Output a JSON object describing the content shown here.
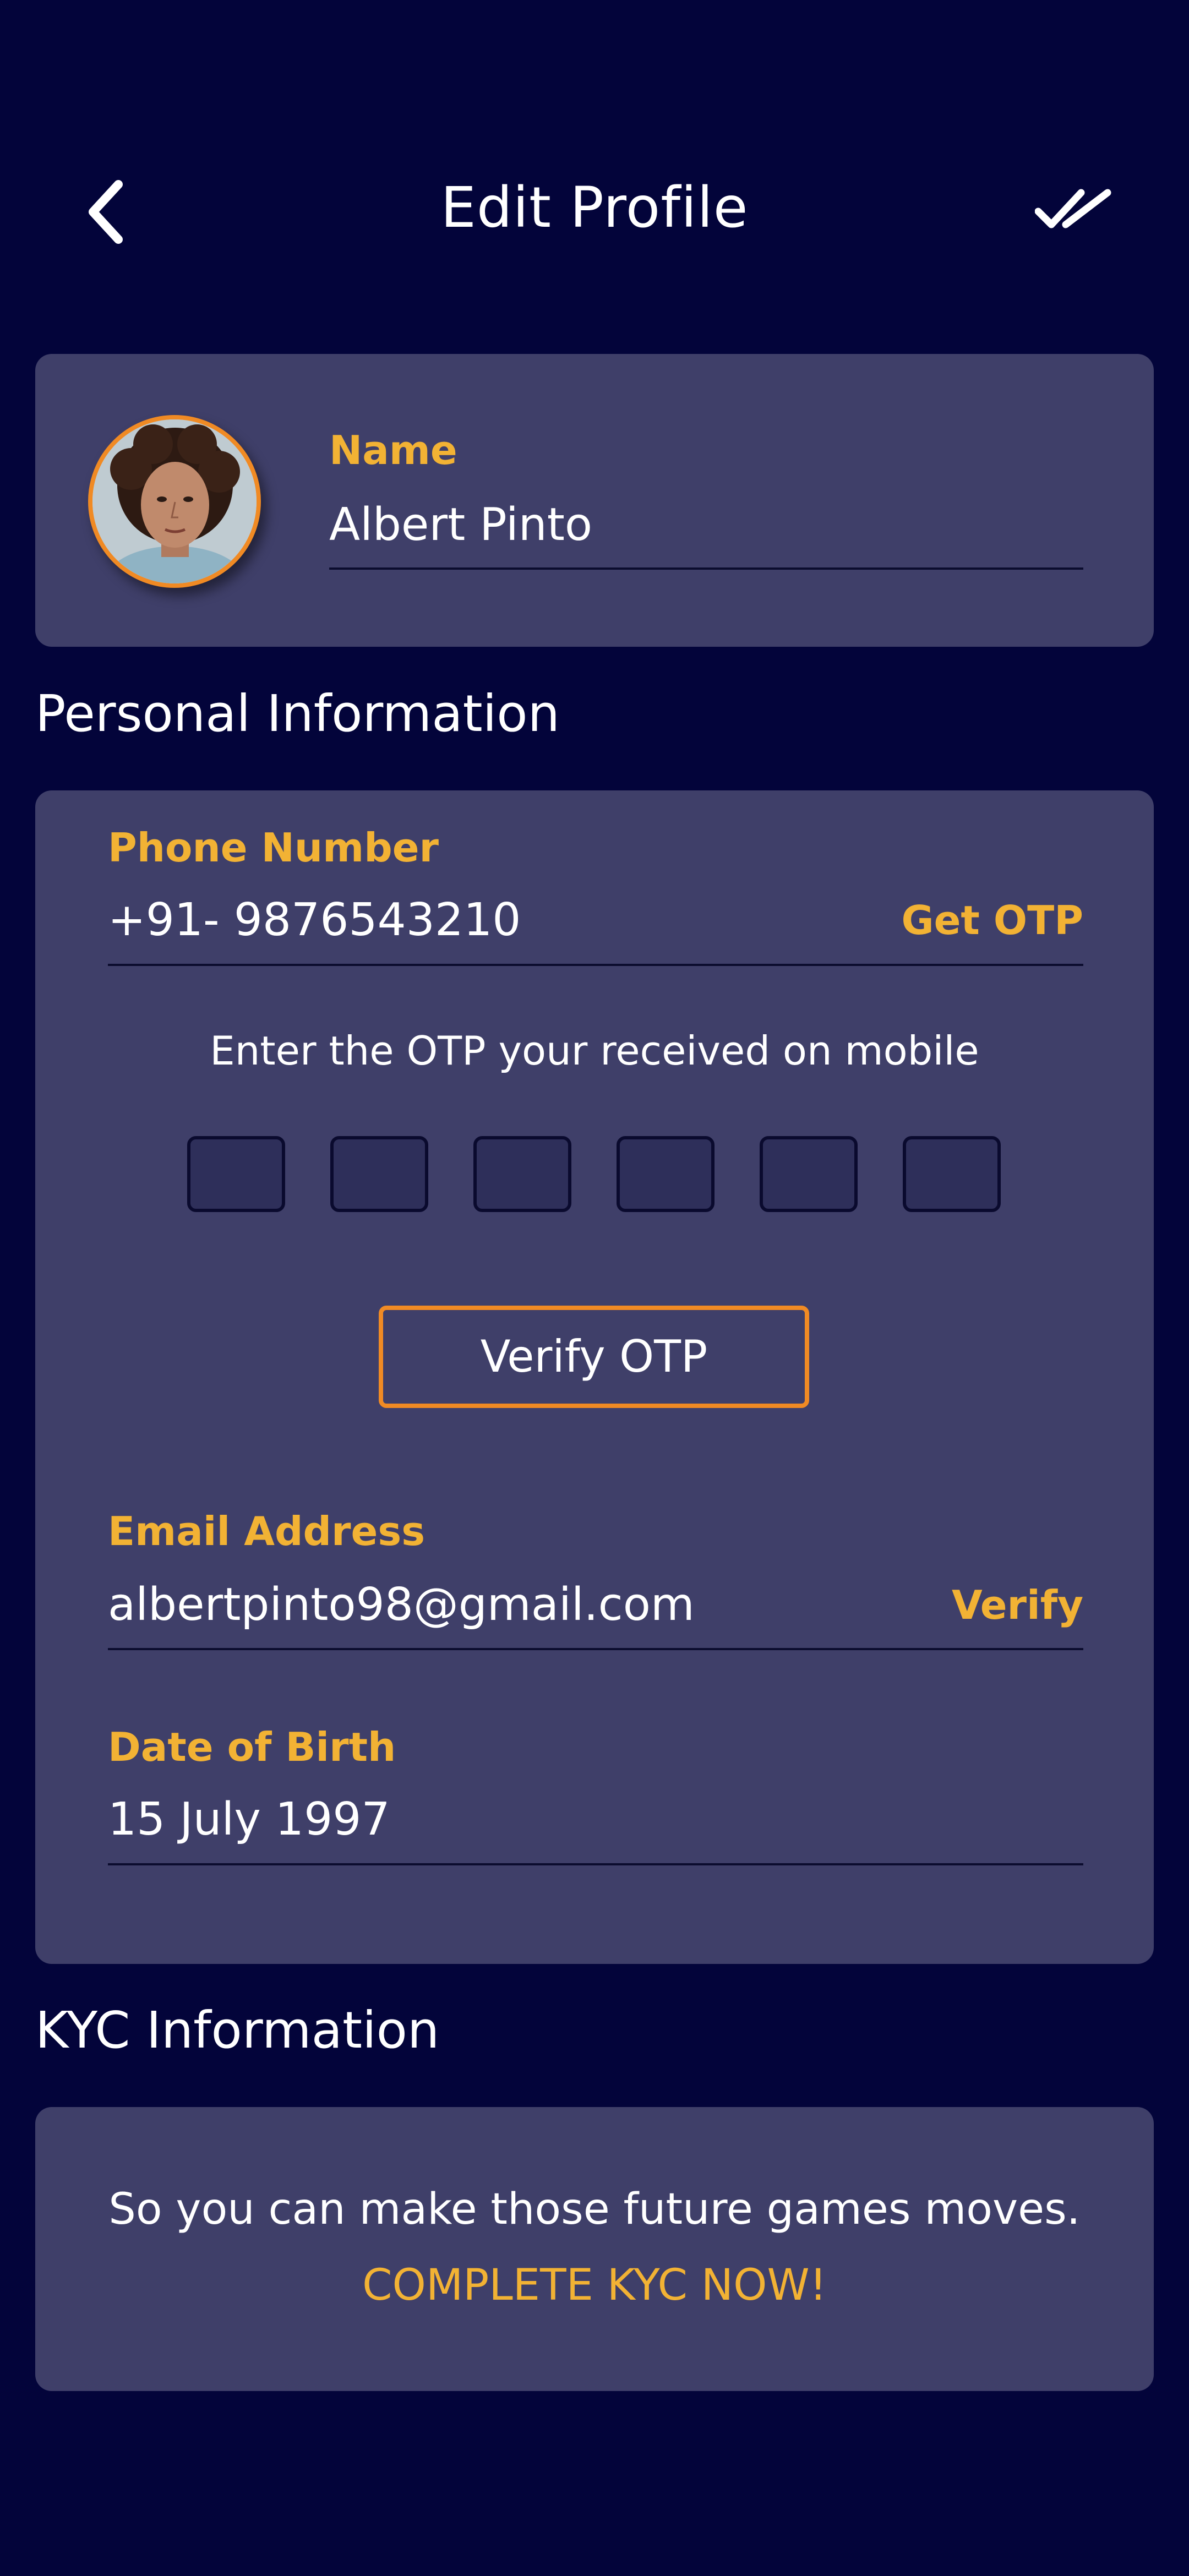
{
  "header": {
    "title": "Edit Profile",
    "back_icon": "chevron-left-icon",
    "done_icon": "double-check-icon"
  },
  "profile": {
    "avatar_icon": "avatar-photo",
    "name_label": "Name",
    "name_value": "Albert Pinto"
  },
  "personal_info": {
    "heading": "Personal Information",
    "phone": {
      "label": "Phone Number",
      "value": "+91- 9876543210",
      "action": "Get OTP"
    },
    "otp": {
      "hint": "Enter the OTP your received on mobile",
      "boxes": [
        "",
        "",
        "",
        "",
        "",
        ""
      ],
      "verify_label": "Verify OTP"
    },
    "email": {
      "label": "Email Address",
      "value": "albertpinto98@gmail.com",
      "action": "Verify"
    },
    "dob": {
      "label": "Date of Birth",
      "value": "15 July 1997"
    }
  },
  "kyc": {
    "heading": "KYC Information",
    "text": "So you can make those future games moves.",
    "cta": "COMPLETE KYC NOW!"
  },
  "colors": {
    "background": "#03043a",
    "card": "#3f3f69",
    "accent": "#f2b234",
    "accent_border": "#f08a24",
    "text": "#ffffff"
  }
}
